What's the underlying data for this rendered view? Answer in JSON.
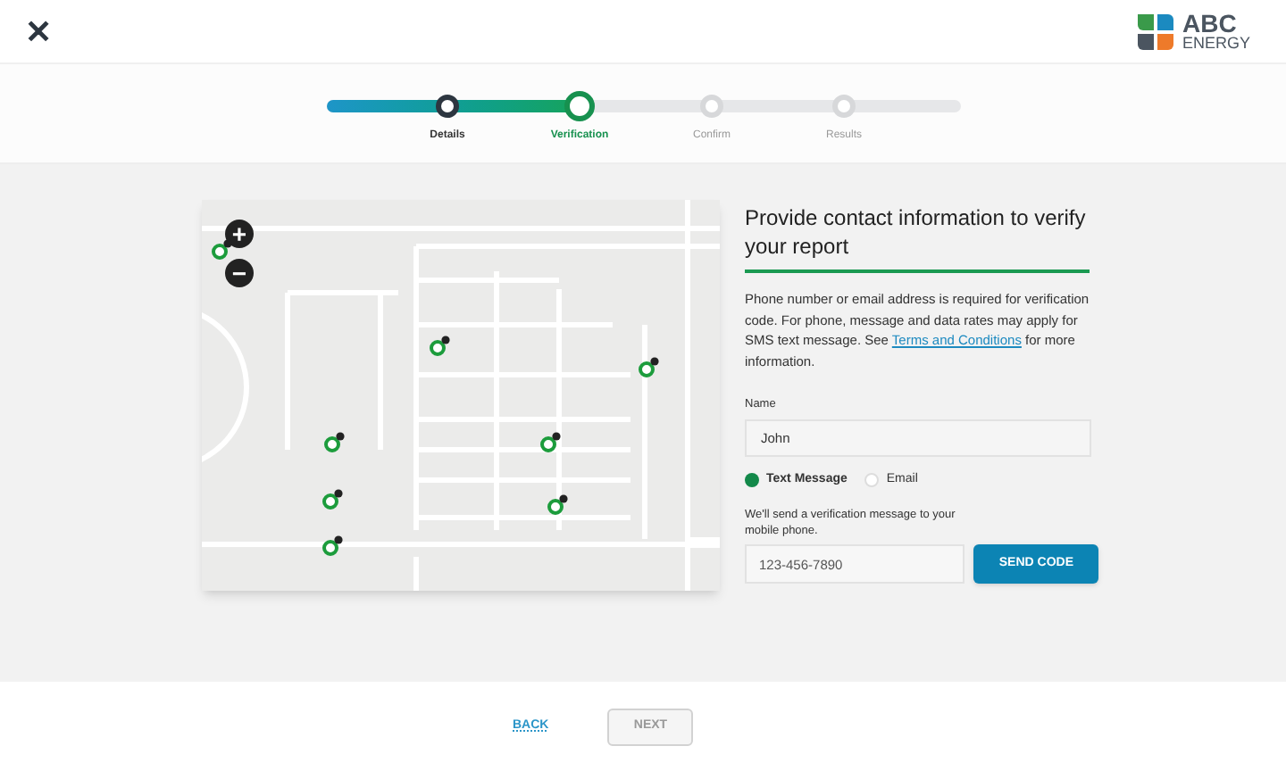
{
  "header": {
    "close": "✕",
    "logo": {
      "line_1": "ABC",
      "line_2": "ENERGY"
    }
  },
  "stepper": {
    "level": 0.4,
    "steps": [
      {
        "label": "Details",
        "completed": true,
        "selected": false
      },
      {
        "label": "Verification",
        "completed": false,
        "selected": true
      },
      {
        "label": "Confirm",
        "completed": false,
        "selected": false
      },
      {
        "label": "Results",
        "completed": false,
        "selected": false
      }
    ]
  },
  "map": {
    "zoom_in": "+",
    "zoom_out": "−"
  },
  "form": {
    "title": "Provide contact information to verify your report",
    "description": "Phone number or email address is required for verification code. For phone, message and data rates may apply for SMS text message. See ",
    "link": "Terms and Conditions",
    "description_end": " for more information.",
    "name_label": "Name",
    "name_value": "John",
    "options": [
      {
        "label": "Text Message",
        "selected": true
      },
      {
        "label": "Email",
        "selected": false
      }
    ],
    "hint": "We'll send a verification message to your mobile phone.",
    "phone_value": "123-456-7890",
    "send_button": "SEND CODE"
  },
  "footer": {
    "back": "BACK",
    "next": "NEXT"
  }
}
